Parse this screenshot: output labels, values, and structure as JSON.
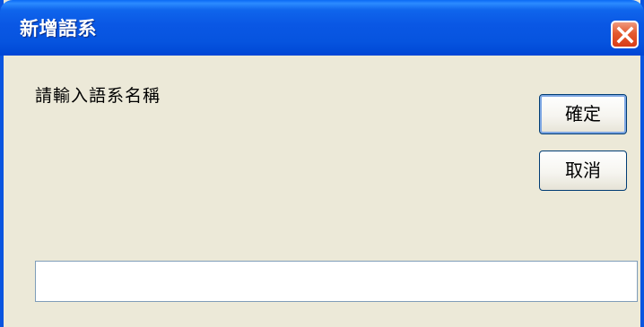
{
  "window": {
    "title": "新增語系",
    "close_icon": "close-icon"
  },
  "prompt": {
    "label": "請輸入語系名稱"
  },
  "buttons": {
    "ok_label": "確定",
    "cancel_label": "取消"
  },
  "input": {
    "value": "",
    "placeholder": ""
  },
  "colors": {
    "titlebar": "#0a57e4",
    "dialog_background": "#ece9d8",
    "close_button": "#e45a2f"
  }
}
